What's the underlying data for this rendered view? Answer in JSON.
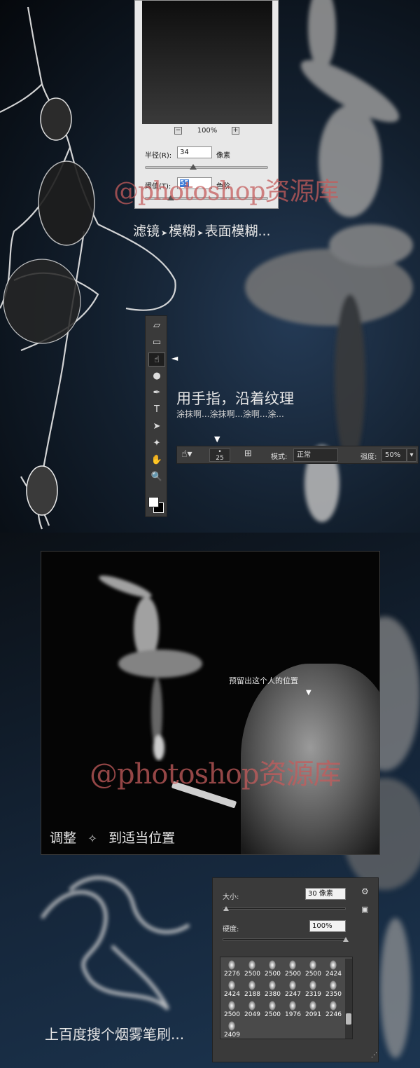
{
  "surface_blur": {
    "zoom": "100%",
    "zoom_minus": "−",
    "zoom_plus": "+",
    "radius_label": "半径(R):",
    "radius_value": "34",
    "radius_unit": "像素",
    "radius_fraction": 0.39,
    "threshold_label": "阈值(T):",
    "threshold_value": "55",
    "threshold_unit": "色阶",
    "threshold_fraction": 0.21
  },
  "watermark": {
    "text": "@photoshop资源库"
  },
  "captions": {
    "menu_path": [
      "滤镜",
      "模糊",
      "表面模糊..."
    ],
    "menu_sep": "➤",
    "smudge_title": "用手指，沿着纹理",
    "smudge_sub": "涂抹啊...涂抹啊...涂啊...涂...",
    "reserve_position": "预留出这个人的位置",
    "adjust_pre": "调整",
    "adjust_post": "到适当位置",
    "smoke_brush": "上百度搜个烟雾笔刷..."
  },
  "toolbar": {
    "tools": [
      {
        "name": "eraser-tool",
        "glyph": "▱"
      },
      {
        "name": "gradient-tool",
        "glyph": "▭"
      },
      {
        "name": "smudge-tool",
        "glyph": "☝"
      },
      {
        "name": "dodge-tool",
        "glyph": "●"
      },
      {
        "name": "pen-tool",
        "glyph": "✒"
      },
      {
        "name": "type-tool",
        "glyph": "T"
      },
      {
        "name": "path-select-tool",
        "glyph": "➤"
      },
      {
        "name": "shape-tool",
        "glyph": "✦"
      },
      {
        "name": "hand-tool",
        "glyph": "✋"
      },
      {
        "name": "zoom-tool",
        "glyph": "🔍"
      }
    ],
    "active_index": 2,
    "pointer": "◄"
  },
  "options_bar": {
    "brush_size": "25",
    "mode_label": "模式:",
    "mode_value": "正常",
    "strength_label": "强度:",
    "strength_value": "50%",
    "pointer": "▼"
  },
  "brush_panel": {
    "size_label": "大小:",
    "size_value": "30 像素",
    "size_fraction": 0.03,
    "hardness_label": "硬度:",
    "hardness_value": "100%",
    "hardness_fraction": 1.0,
    "brushes": [
      "2276",
      "2500",
      "2500",
      "2500",
      "2500",
      "2424",
      "2424",
      "2188",
      "2380",
      "2247",
      "2319",
      "2350",
      "2500",
      "2049",
      "2500",
      "1976",
      "2091",
      "2246",
      "2409"
    ]
  },
  "reserve_pointer": "▼"
}
